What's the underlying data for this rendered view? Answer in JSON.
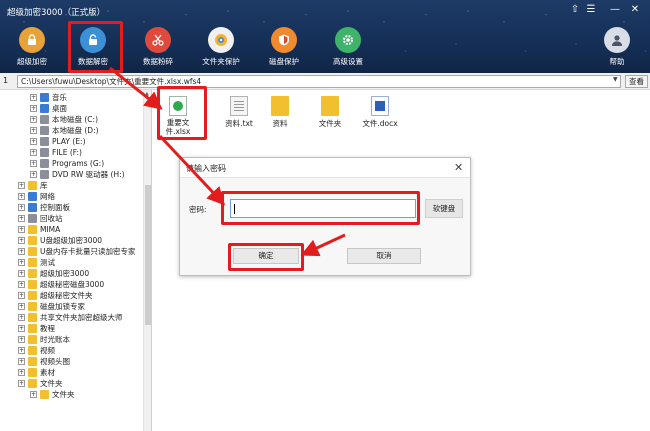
{
  "window": {
    "title": "超级加密3000（正式版）",
    "controls": {
      "pin": "⇧",
      "menu": "☰",
      "minimize": "—",
      "close": "✕"
    }
  },
  "toolbar": {
    "items": [
      {
        "label": "超级加密",
        "icon": "lock-icon",
        "color": "#e8a23a"
      },
      {
        "label": "数据解密",
        "icon": "unlock-icon",
        "color": "#3d8fd6"
      },
      {
        "label": "数据粉碎",
        "icon": "scissors-icon",
        "color": "#e04a3d"
      },
      {
        "label": "文件夹保护",
        "icon": "gear-folder-icon",
        "color": "#f0f0f0"
      },
      {
        "label": "磁盘保护",
        "icon": "shield-icon",
        "color": "#f08a2c"
      },
      {
        "label": "高级设置",
        "icon": "gear-icon",
        "color": "#3fb36a"
      },
      {
        "label": "帮助",
        "icon": "person-icon",
        "color": "#d8dde6"
      }
    ]
  },
  "addressbar": {
    "index": "1",
    "path": "C:\\Users\\fuwu\\Desktop\\文件夹\\重要文件.xlsx.wfs4",
    "view_label": "查看",
    "dropdown": "▼"
  },
  "tree": {
    "items": [
      {
        "label": "音乐",
        "color": "#3b7bd3"
      },
      {
        "label": "桌面",
        "color": "#3b7bd3"
      },
      {
        "label": "本地磁盘 (C:)",
        "color": "#8a8f99"
      },
      {
        "label": "本地磁盘 (D:)",
        "color": "#8a8f99"
      },
      {
        "label": "PLAY (E:)",
        "color": "#8a8f99"
      },
      {
        "label": "FILE (F:)",
        "color": "#8a8f99"
      },
      {
        "label": "Programs (G:)",
        "color": "#8a8f99"
      },
      {
        "label": "DVD RW 驱动器 (H:)",
        "color": "#8a8f99"
      },
      {
        "label": "库",
        "color": "#f2c02f"
      },
      {
        "label": "网络",
        "color": "#3b7bd3"
      },
      {
        "label": "控制面板",
        "color": "#3b7bd3"
      },
      {
        "label": "回收站",
        "color": "#8a8f99"
      },
      {
        "label": "MIMA",
        "color": "#f2c02f"
      },
      {
        "label": "U盘超级加密3000",
        "color": "#f2c02f"
      },
      {
        "label": "U盘内存卡批量只读加密专家",
        "color": "#f2c02f"
      },
      {
        "label": "测试",
        "color": "#f2c02f"
      },
      {
        "label": "超级加密3000",
        "color": "#f2c02f"
      },
      {
        "label": "超级秘密磁盘3000",
        "color": "#f2c02f"
      },
      {
        "label": "超级秘密文件夹",
        "color": "#f2c02f"
      },
      {
        "label": "磁盘加锁专家",
        "color": "#f2c02f"
      },
      {
        "label": "共享文件夹加密超级大师",
        "color": "#f2c02f"
      },
      {
        "label": "教程",
        "color": "#f2c02f"
      },
      {
        "label": "时光账本",
        "color": "#f2c02f"
      },
      {
        "label": "视频",
        "color": "#f2c02f"
      },
      {
        "label": "视频头图",
        "color": "#f2c02f"
      },
      {
        "label": "素材",
        "color": "#f2c02f"
      },
      {
        "label": "文件夹",
        "color": "#f2c02f"
      },
      {
        "label": "文件夹",
        "color": "#f2c02f"
      }
    ]
  },
  "files": [
    {
      "label": "重要文件.xlsx",
      "icon": "excel-file-icon"
    },
    {
      "label": "资料.txt",
      "icon": "text-file-icon"
    },
    {
      "label": "资料",
      "icon": "folder-icon"
    },
    {
      "label": "文件夹",
      "icon": "folder-icon"
    },
    {
      "label": "文件.docx",
      "icon": "word-file-icon"
    }
  ],
  "dialog": {
    "title": "请输入密码",
    "password_label": "密码:",
    "keyboard_button": "软键盘",
    "ok_button": "确定",
    "cancel_button": "取消",
    "close": "✕"
  },
  "accent": {
    "highlight": "#e11d1d",
    "header": "#163058"
  }
}
